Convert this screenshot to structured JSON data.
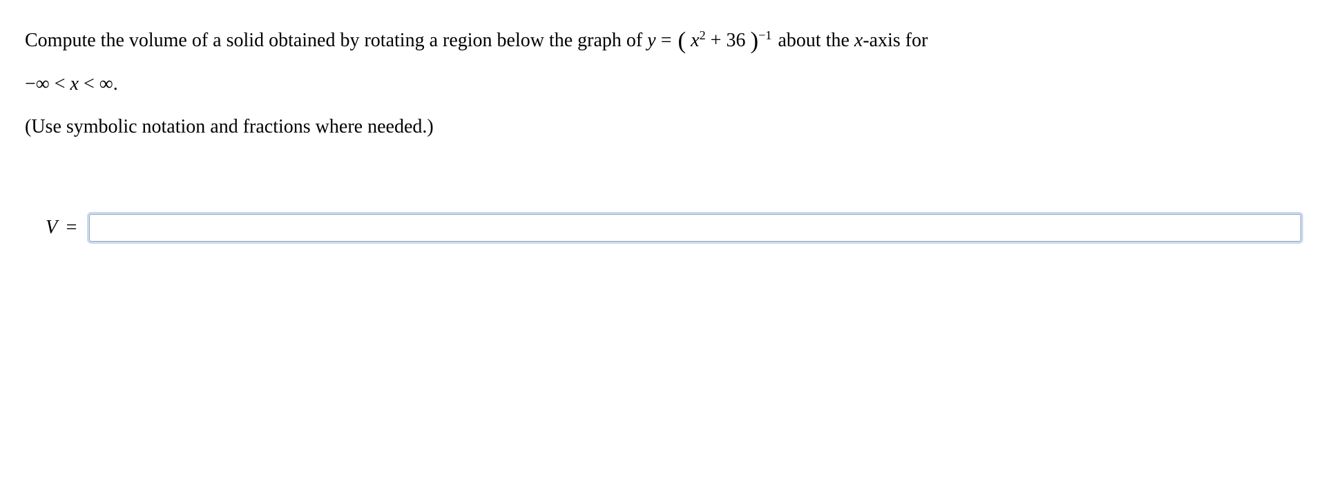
{
  "problem": {
    "prefix": "Compute the volume of a solid obtained by rotating a region below the graph of ",
    "eq_y": "y",
    "eq_equals": " = ",
    "eq_open": "(",
    "eq_x": "x",
    "eq_sq": "2",
    "eq_plus36": " + 36",
    "eq_close": ")",
    "eq_exp": "−1",
    "suffix": " about the ",
    "xaxis_x": "x",
    "xaxis_rest": "-axis for",
    "range_neginf": "−∞ < ",
    "range_x": "x",
    "range_posinf": " < ∞",
    "range_period": "."
  },
  "instruction": "(Use symbolic notation and fractions where needed.)",
  "answer": {
    "label_V": "V",
    "label_eq": "=",
    "value": ""
  }
}
